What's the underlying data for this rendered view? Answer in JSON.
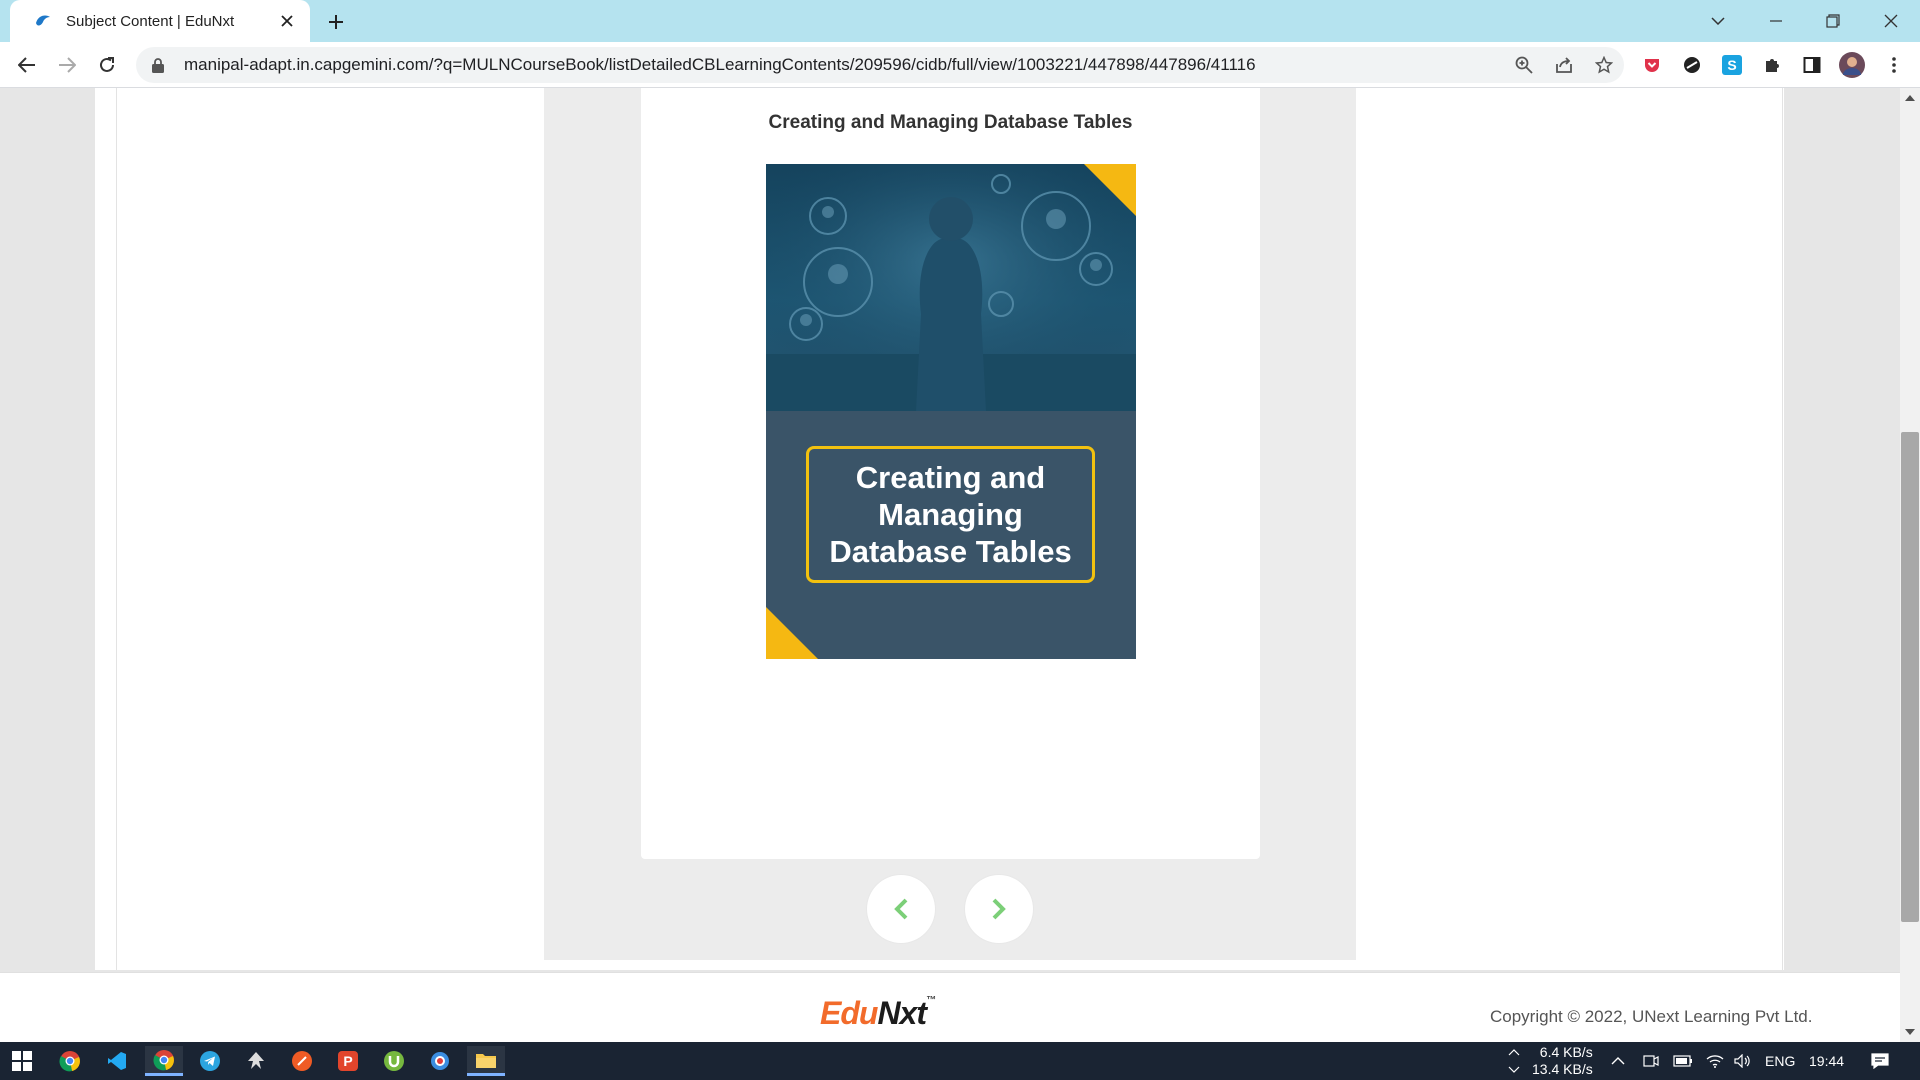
{
  "browser": {
    "tab_title": "Subject Content | EduNxt",
    "url": "manipal-adapt.in.capgemini.com/?q=MULNCourseBook/listDetailedCBLearningContents/209596/cidb/full/view/1003221/447898/447896/41116"
  },
  "content": {
    "section_title": "Creating and Managing Database Tables",
    "cover_text": "Creating and Managing Database Tables"
  },
  "footer": {
    "logo_edu": "Edu",
    "logo_nxt": "Nxt",
    "logo_tm": "™",
    "copyright": "Copyright © 2022, UNext Learning Pvt Ltd."
  },
  "taskbar": {
    "upload_speed": "6.4 KB/s",
    "download_speed": "13.4 KB/s",
    "language": "ENG",
    "time": "19:44"
  },
  "colors": {
    "tabbar_bg": "#b5e3ef",
    "accent_yellow": "#f2c10f",
    "cover_bg": "#3a5468",
    "nav_arrow": "#7ccf78",
    "logo_orange": "#f26b2b"
  }
}
